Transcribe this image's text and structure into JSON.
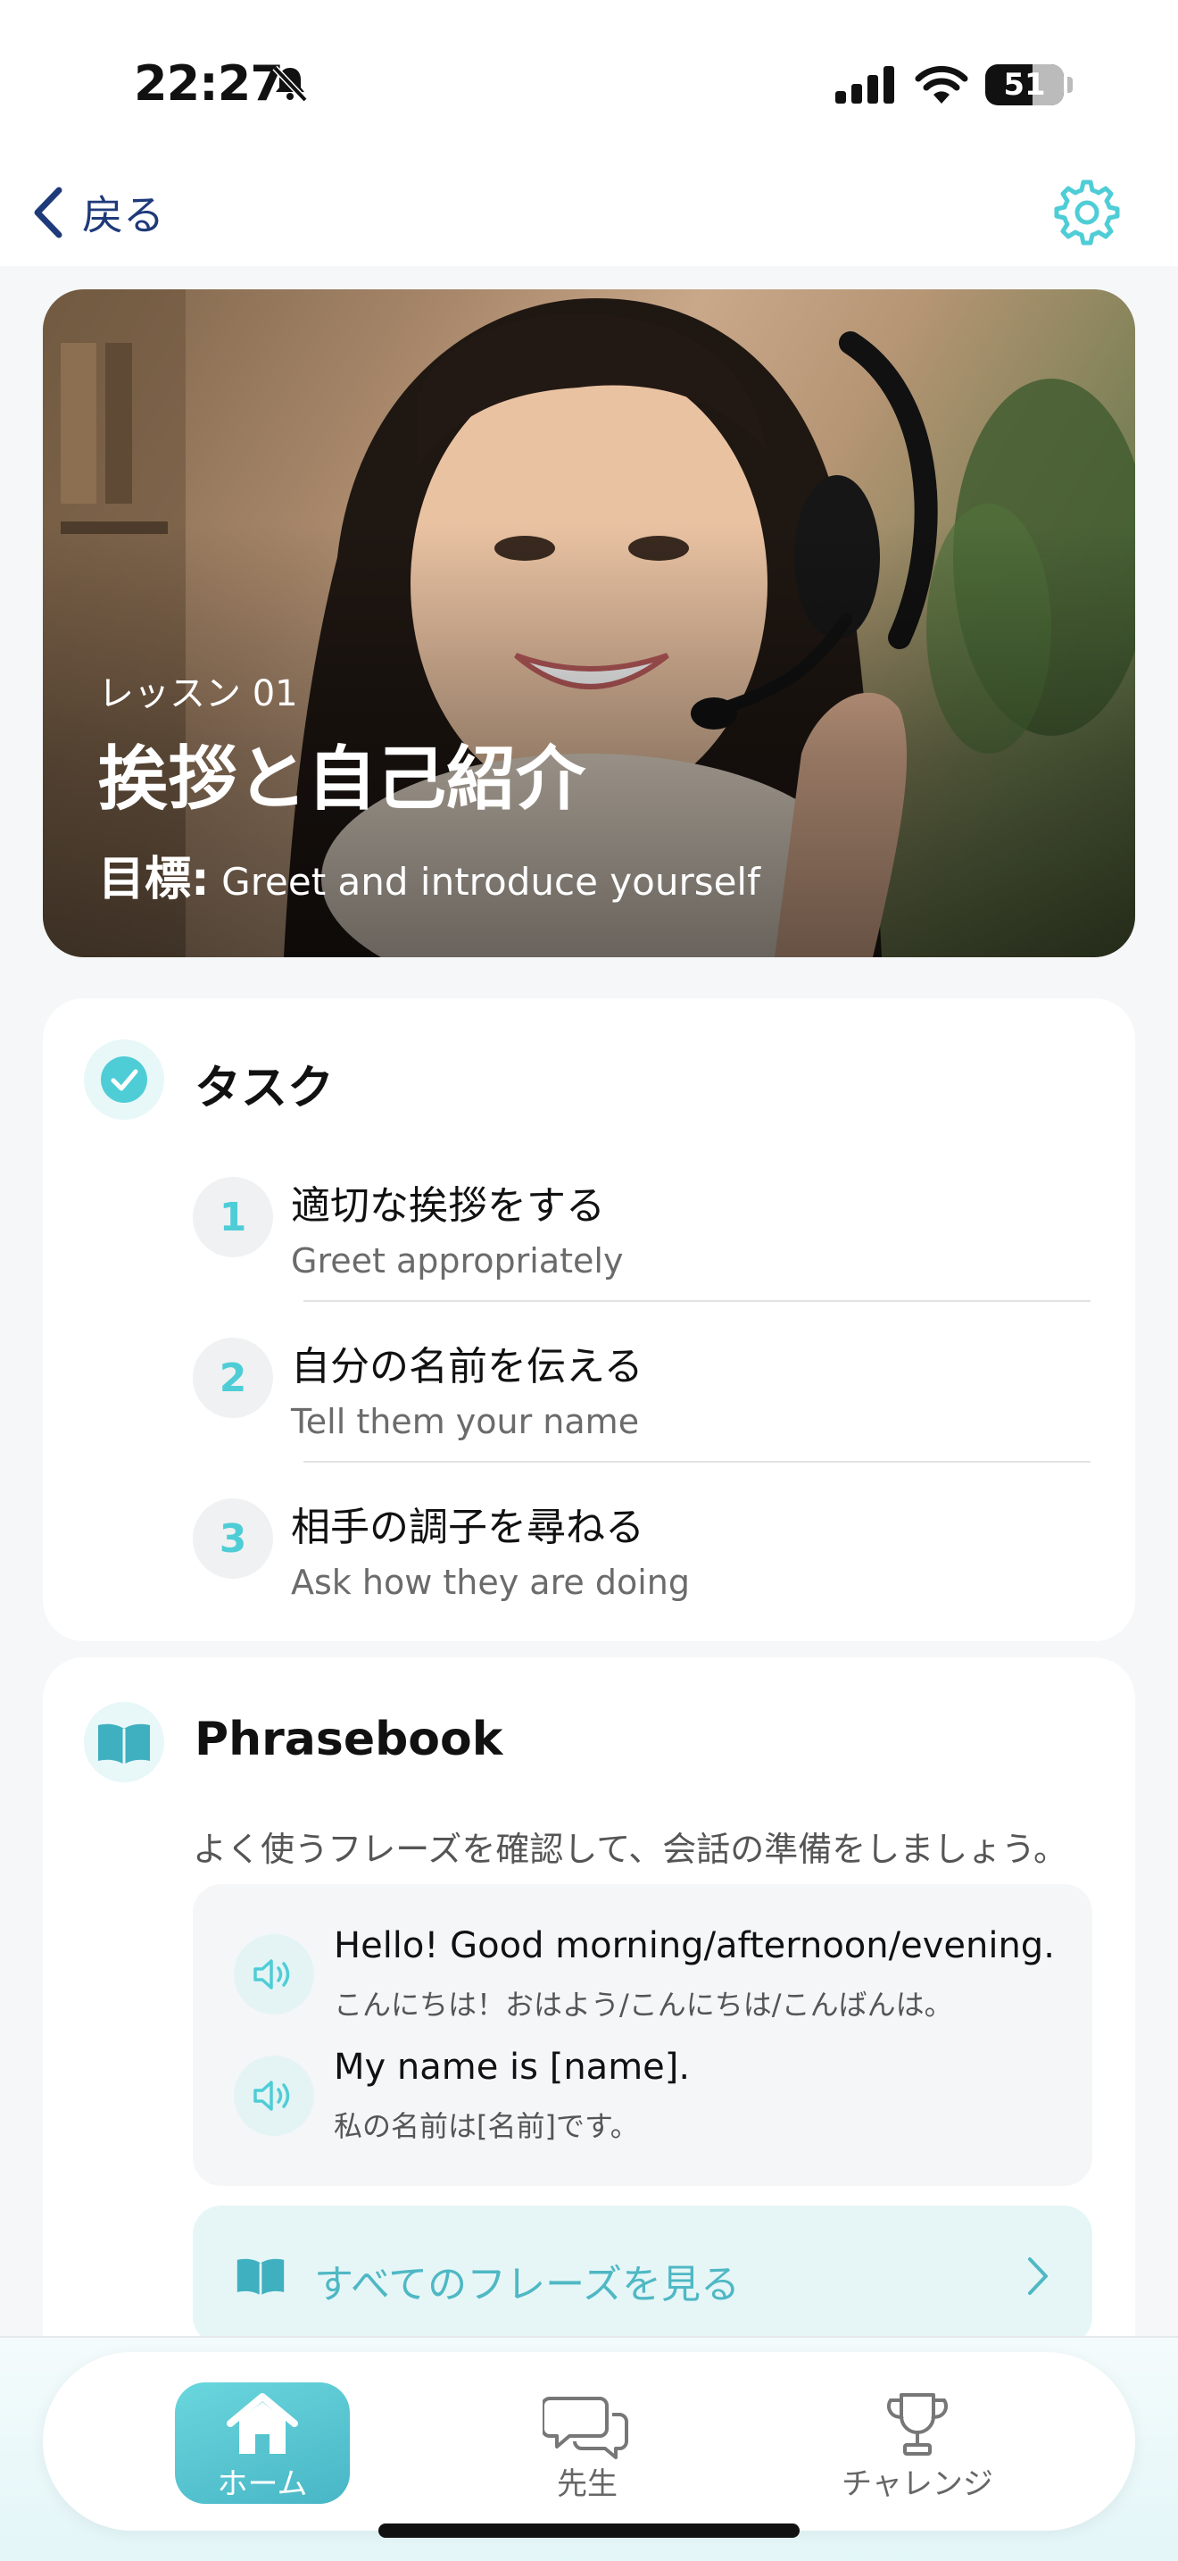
{
  "status_bar": {
    "time": "22:27",
    "battery": "51"
  },
  "nav": {
    "back_label": "戻る"
  },
  "hero": {
    "lesson_label": "レッスン 01",
    "title": "挨拶と自己紹介",
    "goal_label": "目標:",
    "goal_text": "Greet and introduce yourself"
  },
  "tasks": {
    "title": "タスク",
    "items": [
      {
        "num": "1",
        "jp": "適切な挨拶をする",
        "en": "Greet appropriately"
      },
      {
        "num": "2",
        "jp": "自分の名前を伝える",
        "en": "Tell them your name"
      },
      {
        "num": "3",
        "jp": "相手の調子を尋ねる",
        "en": "Ask how they are doing"
      }
    ]
  },
  "phrasebook": {
    "title": "Phrasebook",
    "description": "よく使うフレーズを確認して、会話の準備をしましょう。",
    "phrases": [
      {
        "en": "Hello! Good morning/afternoon/evening.",
        "jp": "こんにちは！おはよう/こんにちは/こんばんは。"
      },
      {
        "en": "My name is [name].",
        "jp": "私の名前は[名前]です。"
      }
    ],
    "see_all_label": "すべてのフレーズを見る"
  },
  "tabs": [
    {
      "label": "ホーム",
      "icon": "home-icon",
      "active": true
    },
    {
      "label": "先生",
      "icon": "chat-bubbles-icon",
      "active": false
    },
    {
      "label": "チャレンジ",
      "icon": "trophy-icon",
      "active": false
    }
  ],
  "colors": {
    "accent": "#4fcdd6",
    "accent_dark": "#48b6c6",
    "nav_text": "#1f3a7a"
  }
}
